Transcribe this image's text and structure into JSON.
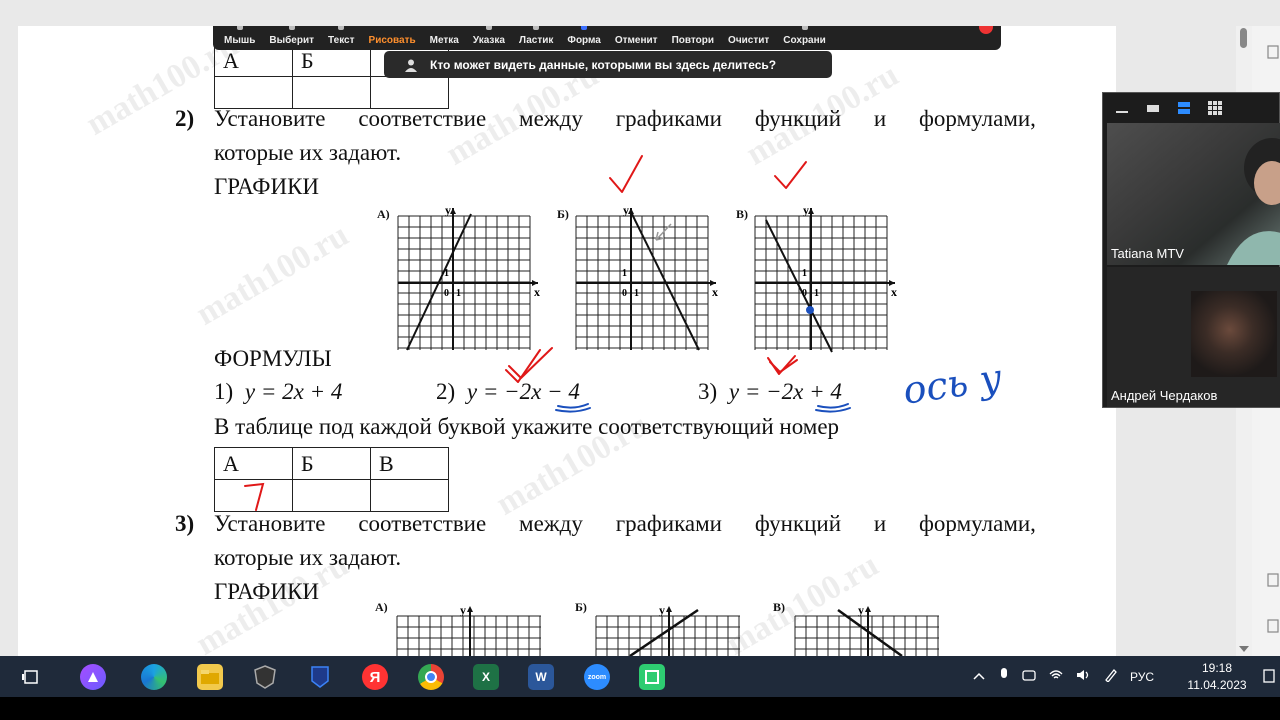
{
  "toolbar": {
    "tools": [
      "Мышь",
      "Выберит",
      "Текст",
      "Рисовать",
      "Метка",
      "Указка",
      "Ластик",
      "Форма",
      "Отменит",
      "Повтори",
      "Очистит",
      "Сохрани"
    ],
    "active_tool": "Рисовать",
    "active_color": "#ff8f2d"
  },
  "share_banner": {
    "text": "Кто может видеть данные, которыми вы здесь делитесь?"
  },
  "document": {
    "top_table": {
      "headers": [
        "А",
        "Б",
        ""
      ],
      "cells": [
        "",
        "",
        ""
      ]
    },
    "task2": {
      "number": "2)",
      "line1_words": [
        "Установите",
        "соответствие",
        "между",
        "графиками",
        "функций",
        "и",
        "формулами,"
      ],
      "line2": "которые их задают.",
      "graphs_heading": "ГРАФИКИ",
      "graph_labels": [
        "А)",
        "Б)",
        "В)"
      ],
      "axis_y": "y",
      "axis_x": "x",
      "tick_one": "1",
      "origin": "0",
      "formulas_heading": "ФОРМУЛЫ",
      "formulas": [
        {
          "num": "1)",
          "text": "y = 2x + 4"
        },
        {
          "num": "2)",
          "text": "y = −2x − 4"
        },
        {
          "num": "3)",
          "text": "y = −2x + 4"
        }
      ],
      "table_instruction": "В таблице под каждой буквой укажите соответствующий номер",
      "answer_table": {
        "headers": [
          "А",
          "Б",
          "В"
        ],
        "answers": [
          "",
          "",
          ""
        ]
      },
      "handwritten_answer_a": "7",
      "handwritten_note": "ось y"
    },
    "task3": {
      "number": "3)",
      "line1_words": [
        "Установите",
        "соответствие",
        "между",
        "графиками",
        "функций",
        "и",
        "формулами,"
      ],
      "line2": "которые их задают.",
      "graphs_heading": "ГРАФИКИ",
      "graph_labels": [
        "А)",
        "Б)",
        "В)"
      ],
      "axis_y": "y"
    },
    "watermark": "math100.ru"
  },
  "video_panel": {
    "participants": [
      {
        "name": "Tatiana MTV"
      },
      {
        "name": "Андрей Чердаков"
      }
    ]
  },
  "taskbar": {
    "apps": [
      "task-view",
      "alice",
      "edge",
      "file-explorer",
      "app-shield",
      "app-badge",
      "yandex",
      "chrome",
      "excel",
      "word",
      "zoom",
      "app-green"
    ],
    "language": "РУС",
    "time": "19:18",
    "date": "11.04.2023"
  }
}
